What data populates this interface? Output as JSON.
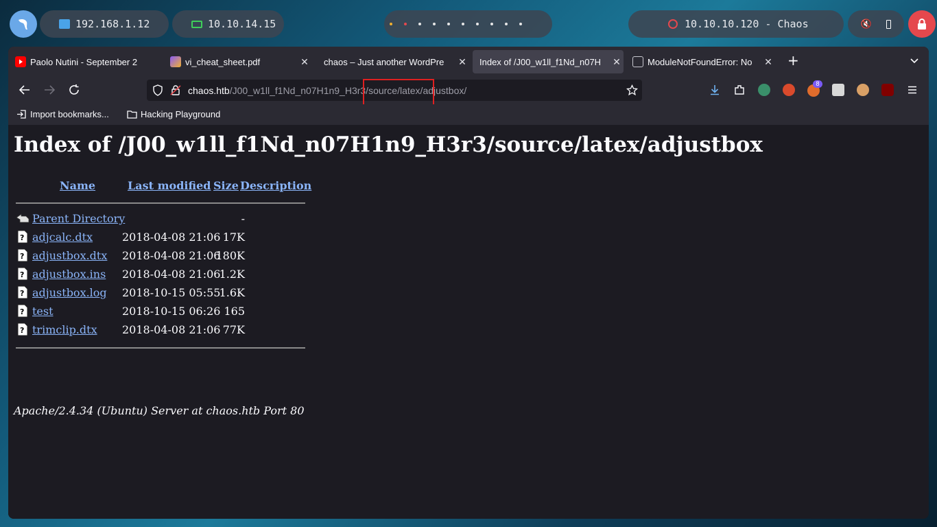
{
  "desktop": {
    "ip_local": "192.168.1.12",
    "ip_vpn": "10.10.14.15",
    "target": "10.10.10.120 - Chaos",
    "accent_local": "#4aa3e8",
    "accent_vpn": "#3fcf5a",
    "accent_target": "#e5484d"
  },
  "tabs": [
    {
      "title": "Paolo Nutini - September 2",
      "icon": "youtube-icon",
      "active": false
    },
    {
      "title": "vi_cheat_sheet.pdf",
      "icon": "pdf-icon",
      "active": false
    },
    {
      "title": "chaos – Just another WordPre",
      "icon": "",
      "active": false
    },
    {
      "title": "Index of /J00_w1ll_f1Nd_n07H",
      "icon": "",
      "active": true
    },
    {
      "title": "ModuleNotFoundError: No",
      "icon": "cube-icon",
      "active": false
    }
  ],
  "url": {
    "host": "chaos.htb",
    "path": "/J00_w1ll_f1Nd_n07H1n9_H3r3/source/latex/adjustbox/"
  },
  "bookmarks": {
    "import": "Import bookmarks...",
    "folder": "Hacking Playground"
  },
  "page": {
    "heading": "Index of /J00_w1ll_f1Nd_n07H1n9_H3r3/source/latex/adjustbox",
    "columns": {
      "name": "Name",
      "modified": "Last modified",
      "size": "Size",
      "description": "Description"
    },
    "entries": [
      {
        "name": "Parent Directory",
        "modified": "",
        "size": "-",
        "icon": "back-folder-icon"
      },
      {
        "name": "adjcalc.dtx",
        "modified": "2018-04-08 21:06",
        "size": "17K",
        "icon": "unknown-file-icon"
      },
      {
        "name": "adjustbox.dtx",
        "modified": "2018-04-08 21:06",
        "size": "180K",
        "icon": "unknown-file-icon"
      },
      {
        "name": "adjustbox.ins",
        "modified": "2018-04-08 21:06",
        "size": "1.2K",
        "icon": "unknown-file-icon"
      },
      {
        "name": "adjustbox.log",
        "modified": "2018-10-15 05:55",
        "size": "1.6K",
        "icon": "unknown-file-icon"
      },
      {
        "name": "test",
        "modified": "2018-10-15 06:26",
        "size": "165",
        "icon": "unknown-file-icon"
      },
      {
        "name": "trimclip.dtx",
        "modified": "2018-04-08 21:06",
        "size": "77K",
        "icon": "unknown-file-icon"
      }
    ],
    "footer": "Apache/2.4.34 (Ubuntu) Server at chaos.htb Port 80"
  }
}
